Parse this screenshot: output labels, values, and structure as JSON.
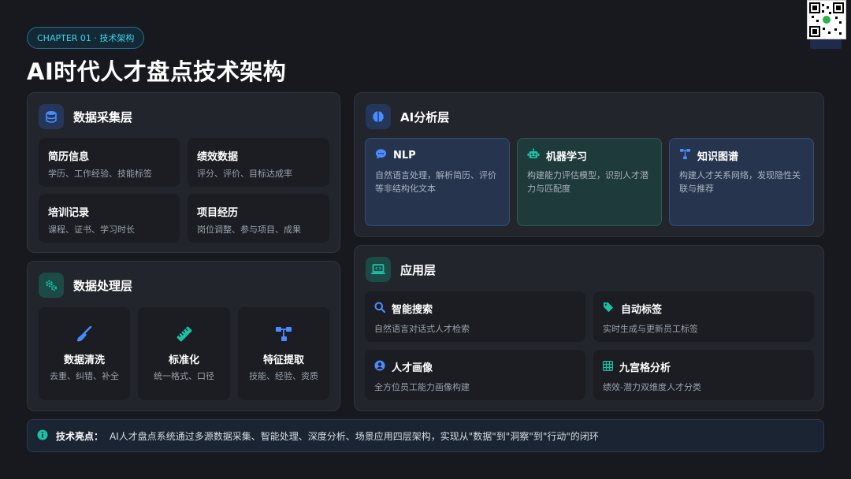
{
  "header": {
    "chapter": "CHAPTER 01 · 技术架构",
    "title": "AI时代人才盘点技术架构"
  },
  "collection": {
    "title": "数据采集层",
    "icon": "database-icon",
    "cards": [
      {
        "title": "简历信息",
        "desc": "学历、工作经验、技能标签"
      },
      {
        "title": "绩效数据",
        "desc": "评分、评价、目标达成率"
      },
      {
        "title": "培训记录",
        "desc": "课程、证书、学习时长"
      },
      {
        "title": "项目经历",
        "desc": "岗位调整、参与项目、成果"
      }
    ]
  },
  "processing": {
    "title": "数据处理层",
    "icon": "gears-icon",
    "cards": [
      {
        "title": "数据清洗",
        "desc": "去重、纠错、补全",
        "icon": "broom-icon"
      },
      {
        "title": "标准化",
        "desc": "统一格式、口径",
        "icon": "ruler-icon"
      },
      {
        "title": "特征提取",
        "desc": "技能、经验、资质",
        "icon": "sitemap-icon"
      }
    ]
  },
  "ai": {
    "title": "AI分析层",
    "icon": "brain-icon",
    "cards": [
      {
        "title": "NLP",
        "desc": "自然语言处理，解析简历、评价等非结构化文本",
        "icon": "chat-icon"
      },
      {
        "title": "机器学习",
        "desc": "构建能力评估模型，识别人才潜力与匹配度",
        "icon": "robot-icon"
      },
      {
        "title": "知识图谱",
        "desc": "构建人才关系网络，发现隐性关联与推荐",
        "icon": "graph-icon"
      }
    ]
  },
  "application": {
    "title": "应用层",
    "icon": "laptop-code-icon",
    "cards": [
      {
        "title": "智能搜索",
        "desc": "自然语言对话式人才检索",
        "icon": "search-icon"
      },
      {
        "title": "自动标签",
        "desc": "实时生成与更新员工标签",
        "icon": "tags-icon"
      },
      {
        "title": "人才画像",
        "desc": "全方位员工能力画像构建",
        "icon": "user-circle-icon"
      },
      {
        "title": "九宫格分析",
        "desc": "绩效-潜力双维度人才分类",
        "icon": "grid-icon"
      }
    ]
  },
  "footer": {
    "label": "技术亮点：",
    "text": "AI人才盘点系统通过多源数据采集、智能处理、深度分析、场景应用四层架构，实现从\"数据\"到\"洞察\"到\"行动\"的闭环",
    "icon": "info-icon"
  },
  "colors": {
    "accent": "#3fd2e8",
    "blue": "#4a8cff",
    "teal": "#19c2a6",
    "background": "#17191e"
  }
}
